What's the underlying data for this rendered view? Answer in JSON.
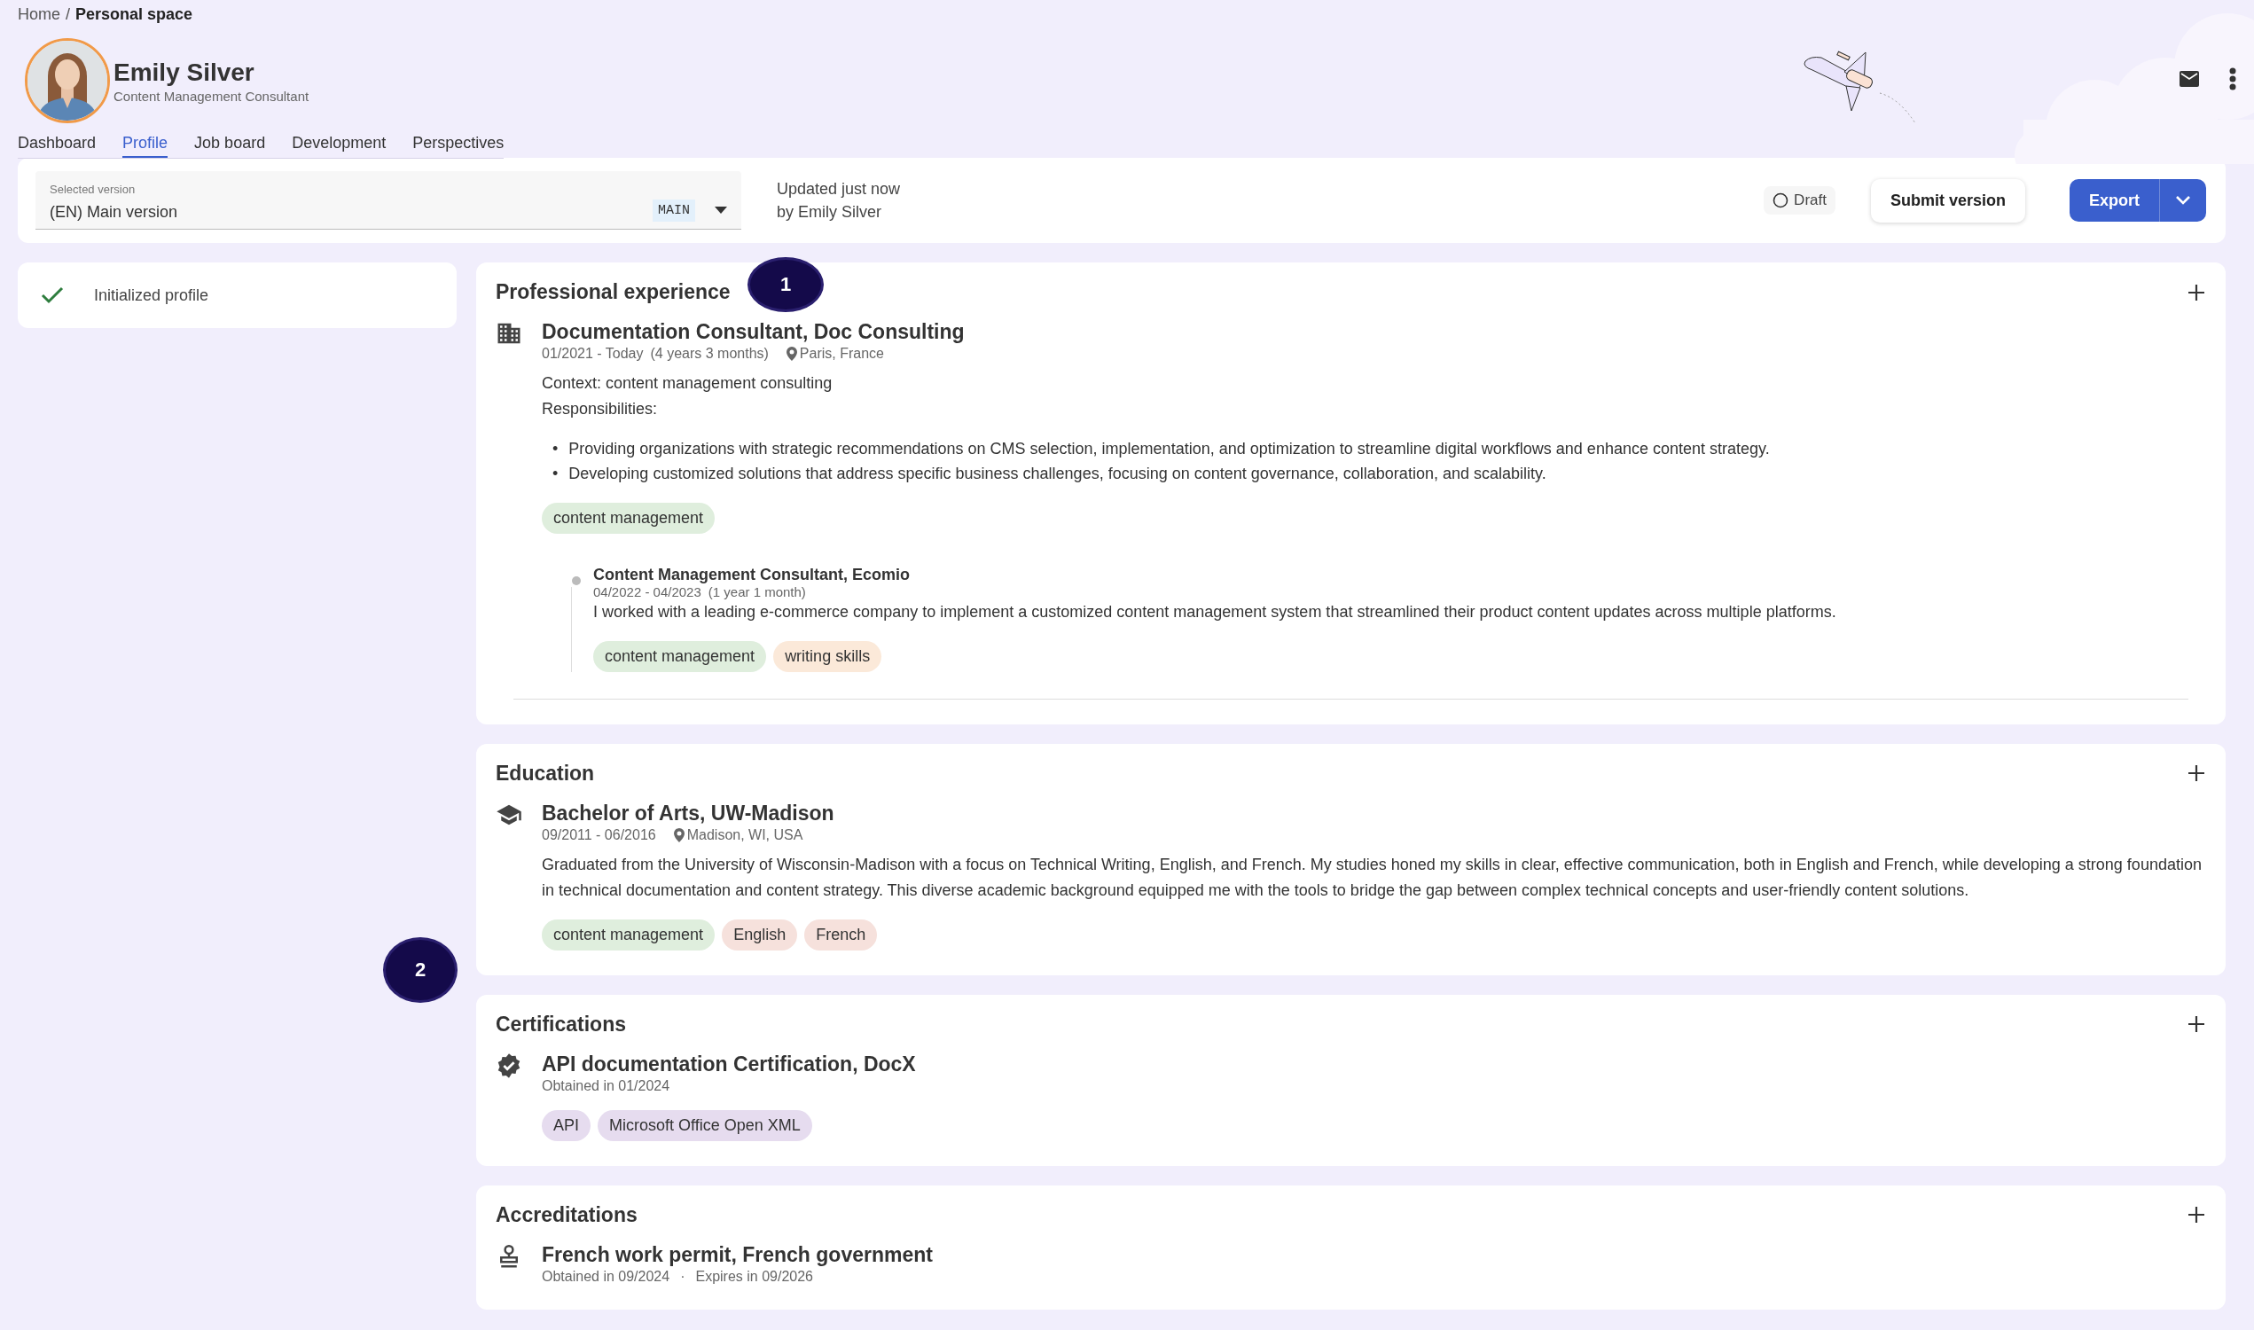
{
  "breadcrumb": {
    "home": "Home",
    "separator": "/",
    "current": "Personal space"
  },
  "profile": {
    "name": "Emily Silver",
    "role": "Content Management Consultant"
  },
  "tabs": [
    {
      "label": "Dashboard",
      "selected": false
    },
    {
      "label": "Profile",
      "selected": true
    },
    {
      "label": "Job board",
      "selected": false
    },
    {
      "label": "Development",
      "selected": false
    },
    {
      "label": "Perspectives",
      "selected": false
    }
  ],
  "version_bar": {
    "field_label": "Selected version",
    "value": "(EN) Main version",
    "tag": "MAIN",
    "updated": "Updated just now",
    "updated_by": "by Emily Silver",
    "status": "Draft",
    "submit": "Submit version",
    "export": "Export"
  },
  "checklist": [
    {
      "label": "Initialized profile",
      "done": true
    }
  ],
  "sections": [
    {
      "title": "Professional experience",
      "kind": "experience",
      "items": [
        {
          "title": "Documentation Consultant, Doc Consulting",
          "dates": "01/2021 - Today",
          "duration": "(4 years 3 months)",
          "location": "Paris, France",
          "lines": [
            "Context: content management consulting",
            "Responsibilities:"
          ],
          "bullet_mark": "•",
          "bullets": [
            "Providing organizations with strategic recommendations on CMS selection, implementation, and optimization to streamline digital workflows and enhance content strategy.",
            "Developing customized solutions that address specific business challenges, focusing on content governance, collaboration, and scalability."
          ],
          "tags": [
            {
              "label": "content management",
              "color": "#dfeedd"
            }
          ],
          "sub_items": [
            {
              "title": "Content Management Consultant, Ecomio",
              "dates": "04/2022 - 04/2023",
              "duration": "(1 year 1 month)",
              "description": "I worked with a leading e-commerce company to implement a customized content management system that streamlined their product content updates across multiple platforms.",
              "tags": [
                {
                  "label": "content management",
                  "color": "#dfeedd"
                },
                {
                  "label": "writing skills",
                  "color": "#fbe9d9"
                }
              ]
            }
          ]
        }
      ]
    },
    {
      "title": "Education",
      "kind": "education",
      "items": [
        {
          "title": "Bachelor of Arts, UW-Madison",
          "dates": "09/2011 - 06/2016",
          "location": "Madison, WI, USA",
          "lines": [
            "Graduated from the University of Wisconsin-Madison with a focus on Technical Writing, English, and French. My studies honed my skills in clear, effective communication, both in English and French, while developing a strong foundation in technical documentation and content strategy. This diverse academic background equipped me with the tools to bridge the gap between complex technical concepts and user-friendly content solutions."
          ],
          "tags": [
            {
              "label": "content management",
              "color": "#dfeedd"
            },
            {
              "label": "English",
              "color": "#f6e1dc"
            },
            {
              "label": "French",
              "color": "#f6e1dc"
            }
          ]
        }
      ]
    },
    {
      "title": "Certifications",
      "kind": "certification",
      "items": [
        {
          "title": "API documentation Certification, DocX",
          "dates": "Obtained in 01/2024",
          "tags": [
            {
              "label": "API",
              "color": "#e6dcef"
            },
            {
              "label": "Microsoft Office Open XML",
              "color": "#e6dcef"
            }
          ]
        }
      ]
    },
    {
      "title": "Accreditations",
      "kind": "accreditation",
      "items": [
        {
          "title": "French work permit, French government",
          "dates": "Obtained in 09/2024",
          "separator": "·",
          "expires": "Expires in 09/2026"
        }
      ]
    }
  ],
  "markers": [
    {
      "label": "1"
    },
    {
      "label": "2"
    }
  ]
}
